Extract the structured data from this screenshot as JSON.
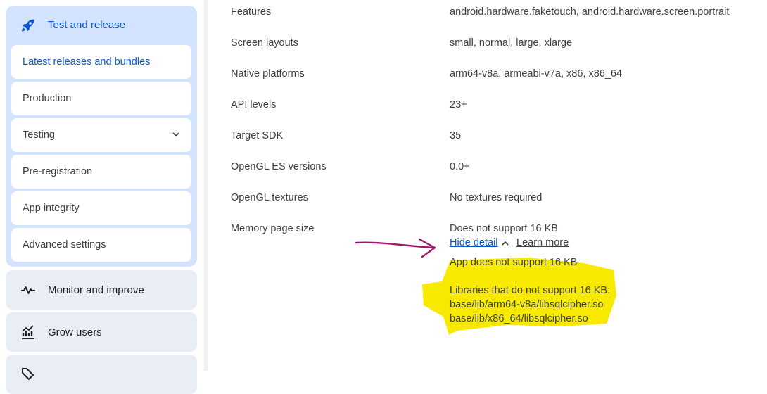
{
  "sidebar": {
    "group": {
      "label": "Test and release",
      "items": [
        {
          "label": "Latest releases and bundles"
        },
        {
          "label": "Production"
        },
        {
          "label": "Testing"
        },
        {
          "label": "Pre-registration"
        },
        {
          "label": "App integrity"
        },
        {
          "label": "Advanced settings"
        }
      ]
    },
    "cards": [
      {
        "label": "Monitor and improve",
        "icon": "vitals-icon"
      },
      {
        "label": "Grow users",
        "icon": "grow-chart-icon"
      }
    ]
  },
  "details": {
    "rows": [
      {
        "label": "Features",
        "value": "android.hardware.faketouch, android.hardware.screen.portrait"
      },
      {
        "label": "Screen layouts",
        "value": "small, normal, large, xlarge"
      },
      {
        "label": "Native platforms",
        "value": "arm64-v8a, armeabi-v7a, x86, x86_64"
      },
      {
        "label": "API levels",
        "value": "23+"
      },
      {
        "label": "Target SDK",
        "value": "35"
      },
      {
        "label": "OpenGL ES versions",
        "value": "0.0+"
      },
      {
        "label": "OpenGL textures",
        "value": "No textures required"
      },
      {
        "label": "Memory page size",
        "value": "Does not support 16 KB"
      }
    ],
    "hide_detail": "Hide detail",
    "learn_more": "Learn more",
    "detail_lines": [
      "App does not support 16 KB",
      "Libraries that do not support 16 KB:",
      "base/lib/arm64-v8a/libsqlcipher.so",
      "base/lib/x86_64/libsqlcipher.so"
    ]
  },
  "colors": {
    "accent": "#0b57d0",
    "highlight": "#f7ea00",
    "annotation_arrow": "#9c1a6b"
  }
}
